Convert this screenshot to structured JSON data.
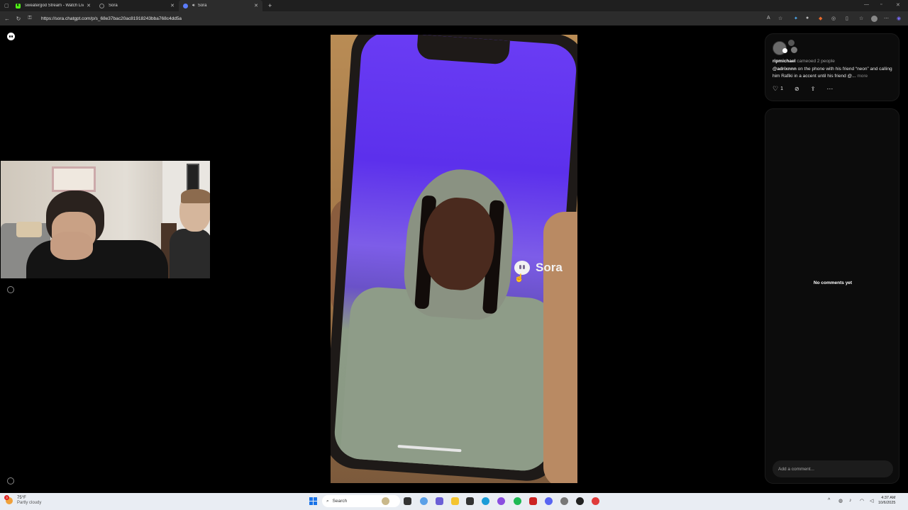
{
  "browser": {
    "tabs": [
      {
        "title": "sweatergod Stream - Watch Live o",
        "favicon": "kick-icon",
        "active": false
      },
      {
        "title": "Sora",
        "favicon": "sora-icon",
        "active": false
      },
      {
        "title": "Sora",
        "favicon": "sora-icon",
        "active": true
      }
    ],
    "url": "https://sora.chatgpt.com/p/s_68e37bac20ac81918243bba768c4dd5a"
  },
  "video": {
    "watermark": "Sora"
  },
  "post": {
    "username": "ripmichael",
    "cameo_text": "cameoed 2 people",
    "caption_tag": "@adrixnnn",
    "caption_body": " on the phone with his friend “neon” and calling him Rafiki in a accent until his friend @...",
    "more_label": "more",
    "like_count": "1"
  },
  "comments": {
    "empty_text": "No comments yet",
    "input_placeholder": "Add a comment..."
  },
  "taskbar": {
    "weather_temp": "75°F",
    "weather_desc": "Partly cloudy",
    "weather_badge": "3",
    "search_placeholder": "Search",
    "time": "4:37 AM",
    "date": "10/6/2025"
  },
  "colors": {
    "kick_green": "#53fc18",
    "accent_blue": "#1a73e8"
  }
}
